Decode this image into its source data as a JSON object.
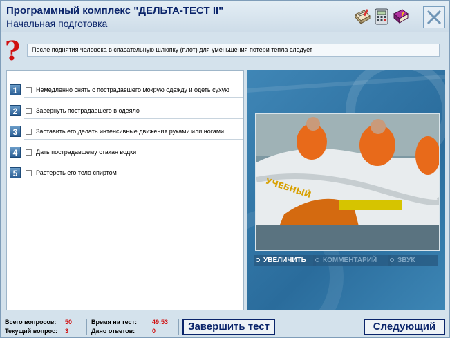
{
  "header": {
    "title": "Программный комплекс \"ДЕЛЬТА-ТЕСТ II\"",
    "subtitle": "Начальная подготовка",
    "tools": [
      "notepad-icon",
      "calculator-icon",
      "help-book-icon"
    ]
  },
  "question": {
    "mark": "?",
    "text": "После поднятия человека в спасательную шлюпку (плот) для уменьшения потери тепла следует"
  },
  "answers": [
    {
      "number": "1",
      "label": "Немедленно снять с пострадавшего мокрую одежду и одеть сухую"
    },
    {
      "number": "2",
      "label": "Завернуть пострадавшего в одеяло"
    },
    {
      "number": "3",
      "label": "Заставить его делать интенсивные движения руками или ногами"
    },
    {
      "number": "4",
      "label": "Дать пострадавшему стакан водки"
    },
    {
      "number": "5",
      "label": "Растереть его тело спиртом"
    }
  ],
  "media": {
    "photo_text": "УЧЕБНЫЙ",
    "zoom_label": "УВЕЛИЧИТЬ",
    "comment_label": "КОММЕНТАРИЙ",
    "sound_label": "ЗВУК"
  },
  "footer": {
    "total_label": "Всего вопросов:",
    "total_value": "50",
    "current_label": "Текущий вопрос:",
    "current_value": "3",
    "time_label": "Время на тест:",
    "time_value": "49:53",
    "answered_label": "Дано ответов:",
    "answered_value": "0",
    "finish_label": "Завершить тест",
    "next_label": "Следующий"
  },
  "colors": {
    "accent": "#0a246a",
    "value_red": "#d01010",
    "media_blue": "#2a6c9c"
  }
}
